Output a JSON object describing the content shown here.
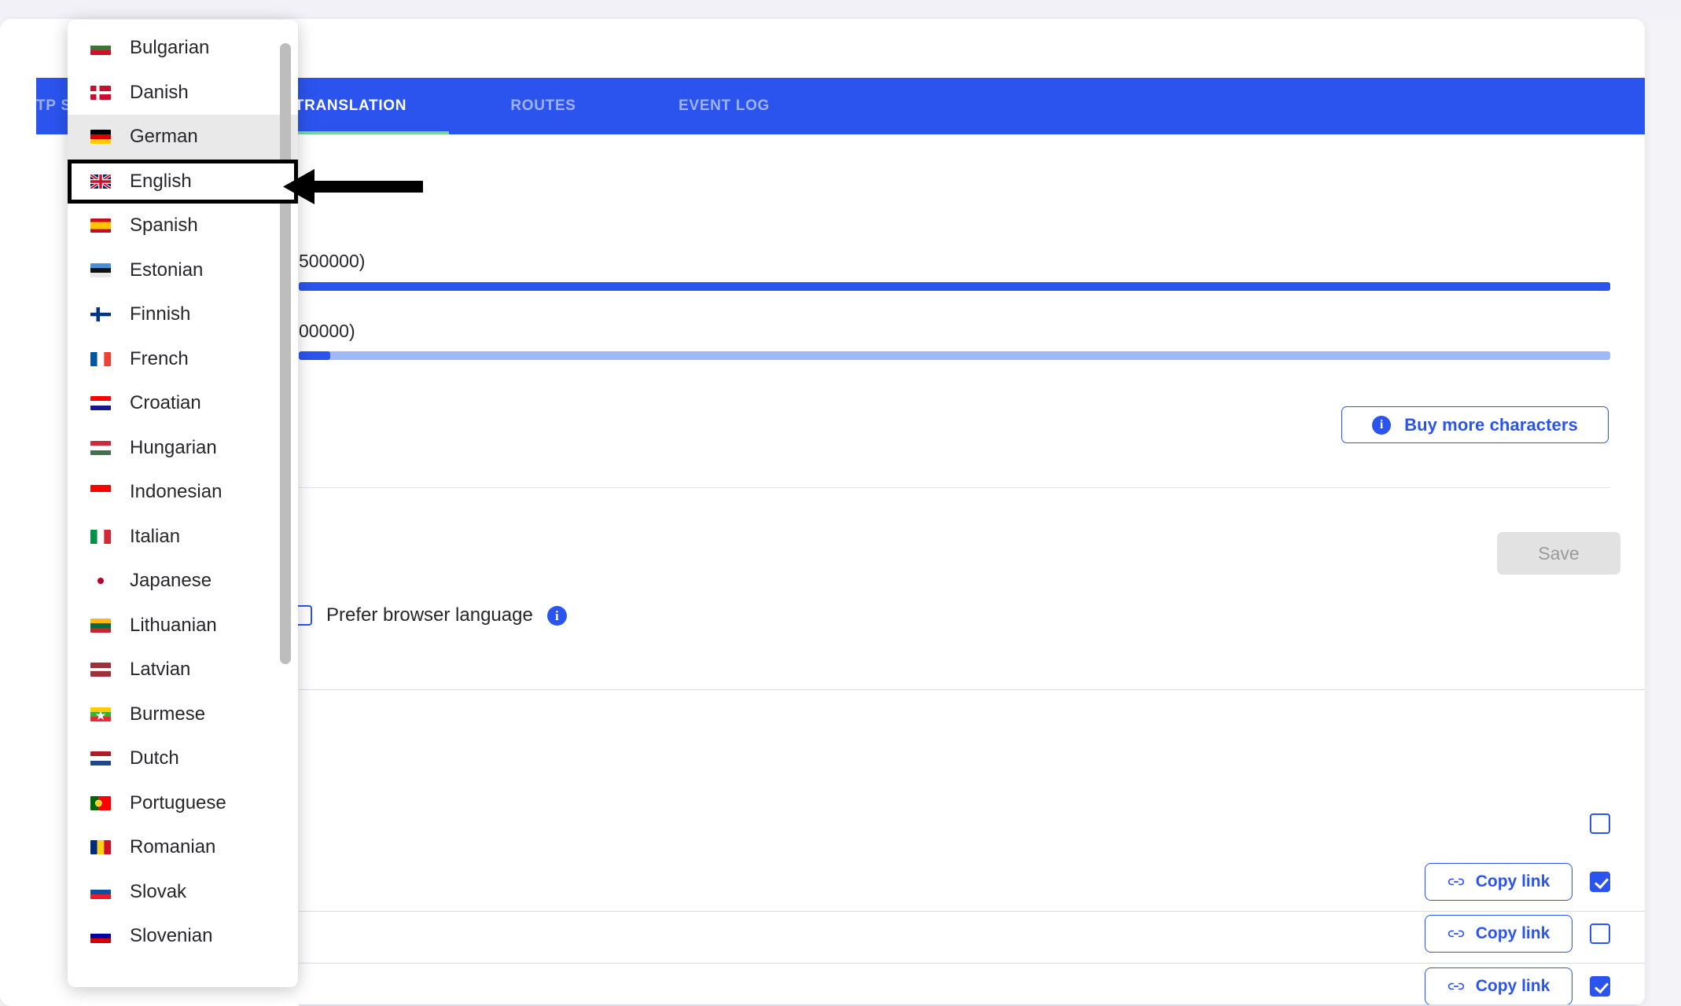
{
  "tabs": [
    {
      "label": "TP SETTINGS",
      "active": false,
      "name": "tab-smtp-settings"
    },
    {
      "label": "TRANSLATION",
      "active": true,
      "name": "tab-translation"
    },
    {
      "label": "ROUTES",
      "active": false,
      "name": "tab-routes"
    },
    {
      "label": "EVENT LOG",
      "active": false,
      "name": "tab-event-log"
    }
  ],
  "usage": {
    "row1_label": "500000)",
    "row1_percent": 100,
    "row2_label": "00000)",
    "row2_percent": 2.4
  },
  "buy_button": {
    "label": "Buy more characters",
    "icon": "info-icon"
  },
  "save_button": {
    "label": "Save"
  },
  "prefer": {
    "label": "Prefer browser language",
    "checked": false,
    "info_icon": "info-icon"
  },
  "rows": [
    {
      "copy_label": "",
      "has_copy": false,
      "checked": false
    },
    {
      "copy_label": "Copy link",
      "has_copy": true,
      "checked": true
    },
    {
      "copy_label": "Copy link",
      "has_copy": true,
      "checked": false
    },
    {
      "copy_label": "Copy link",
      "has_copy": true,
      "checked": true
    }
  ],
  "copy_link_label": "Copy link",
  "dropdown": {
    "items": [
      {
        "label": "Bulgarian",
        "flag": "bg",
        "state": ""
      },
      {
        "label": "Danish",
        "flag": "dk",
        "state": ""
      },
      {
        "label": "German",
        "flag": "de",
        "state": "hover"
      },
      {
        "label": "English",
        "flag": "gb",
        "state": "selected"
      },
      {
        "label": "Spanish",
        "flag": "es",
        "state": ""
      },
      {
        "label": "Estonian",
        "flag": "ee",
        "state": ""
      },
      {
        "label": "Finnish",
        "flag": "fi",
        "state": ""
      },
      {
        "label": "French",
        "flag": "fr",
        "state": ""
      },
      {
        "label": "Croatian",
        "flag": "hr",
        "state": ""
      },
      {
        "label": "Hungarian",
        "flag": "hu",
        "state": ""
      },
      {
        "label": "Indonesian",
        "flag": "id",
        "state": ""
      },
      {
        "label": "Italian",
        "flag": "it",
        "state": ""
      },
      {
        "label": "Japanese",
        "flag": "jp",
        "state": ""
      },
      {
        "label": "Lithuanian",
        "flag": "lt",
        "state": ""
      },
      {
        "label": "Latvian",
        "flag": "lv",
        "state": ""
      },
      {
        "label": "Burmese",
        "flag": "mm",
        "state": ""
      },
      {
        "label": "Dutch",
        "flag": "nl",
        "state": ""
      },
      {
        "label": "Portuguese",
        "flag": "pt",
        "state": ""
      },
      {
        "label": "Romanian",
        "flag": "ro",
        "state": ""
      },
      {
        "label": "Slovak",
        "flag": "sk",
        "state": ""
      },
      {
        "label": "Slovenian",
        "flag": "si",
        "state": ""
      }
    ]
  },
  "colors": {
    "accent": "#2b54ee",
    "tabbar": "#2b54ee",
    "active_underline": "#79d39a",
    "bar_full": "#2b54ee",
    "bar_track_light": "#9fb8f8",
    "disabled_button": "#e2e2e2"
  }
}
